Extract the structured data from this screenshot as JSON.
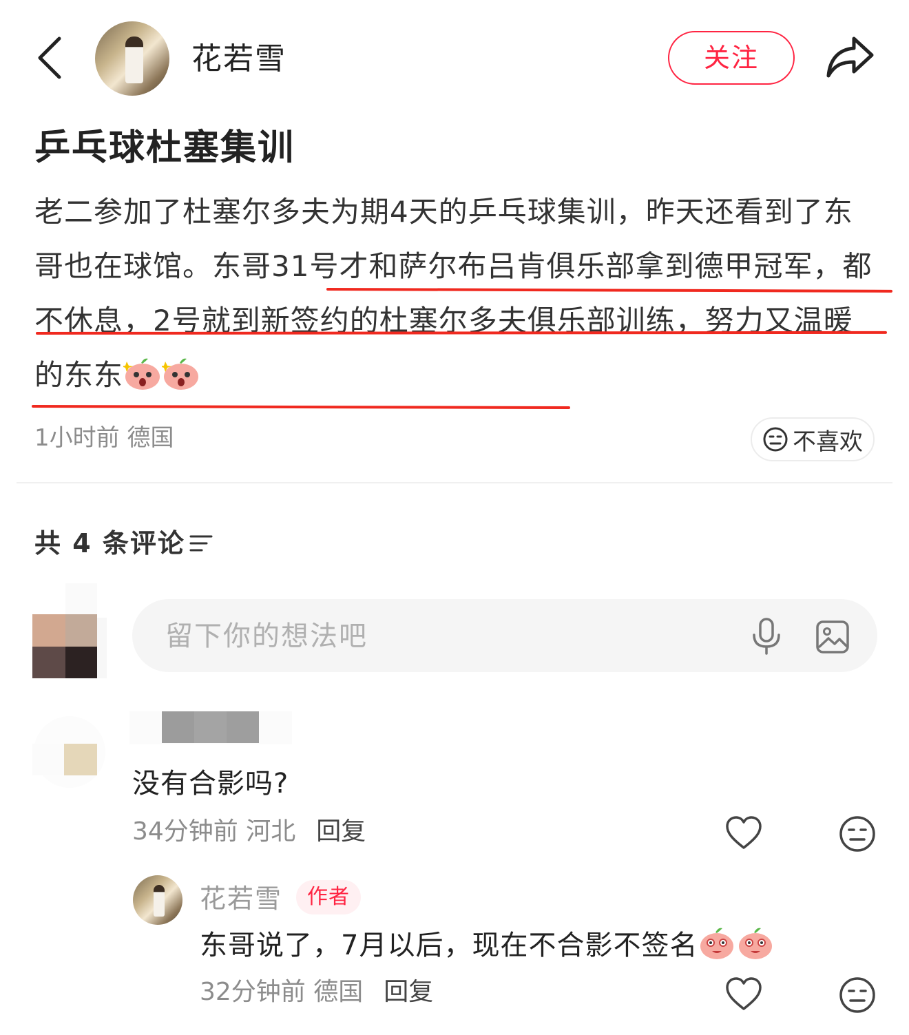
{
  "header": {
    "back_icon": "chevron-left-icon",
    "author_name": "花若雪",
    "follow_label": "关注",
    "share_icon": "share-arrow-icon",
    "accent_color": "#ff2442"
  },
  "post": {
    "title": "乒乓球杜塞集训",
    "body_part1": "老二参加了杜塞尔多夫为期4天的乒乓球集训，昨天还看到了东哥也在球馆。",
    "body_part2": "东哥31号才和萨尔布吕肯俱乐部拿到德甲冠军，都不休息，2号就到新签约的杜塞尔多夫俱乐部训练，努力又温暖的东东",
    "body_emoji": [
      "shocked-peach-emoji",
      "shocked-peach-emoji"
    ],
    "underline_color": "#f0291f",
    "time": "1小时前",
    "location": "德国",
    "dislike_label": "不喜欢"
  },
  "comments": {
    "count_label": "共 4 条评论",
    "input_placeholder": "留下你的想法吧",
    "items": [
      {
        "text": "没有合影吗?",
        "time": "34分钟前",
        "location": "河北",
        "reply_label": "回复"
      },
      {
        "name": "花若雪",
        "badge": "作者",
        "text": "东哥说了，7月以后，现在不合影不签名",
        "emoji": [
          "giggle-peach-emoji",
          "giggle-peach-emoji"
        ],
        "time": "32分钟前",
        "location": "德国",
        "reply_label": "回复"
      }
    ]
  }
}
